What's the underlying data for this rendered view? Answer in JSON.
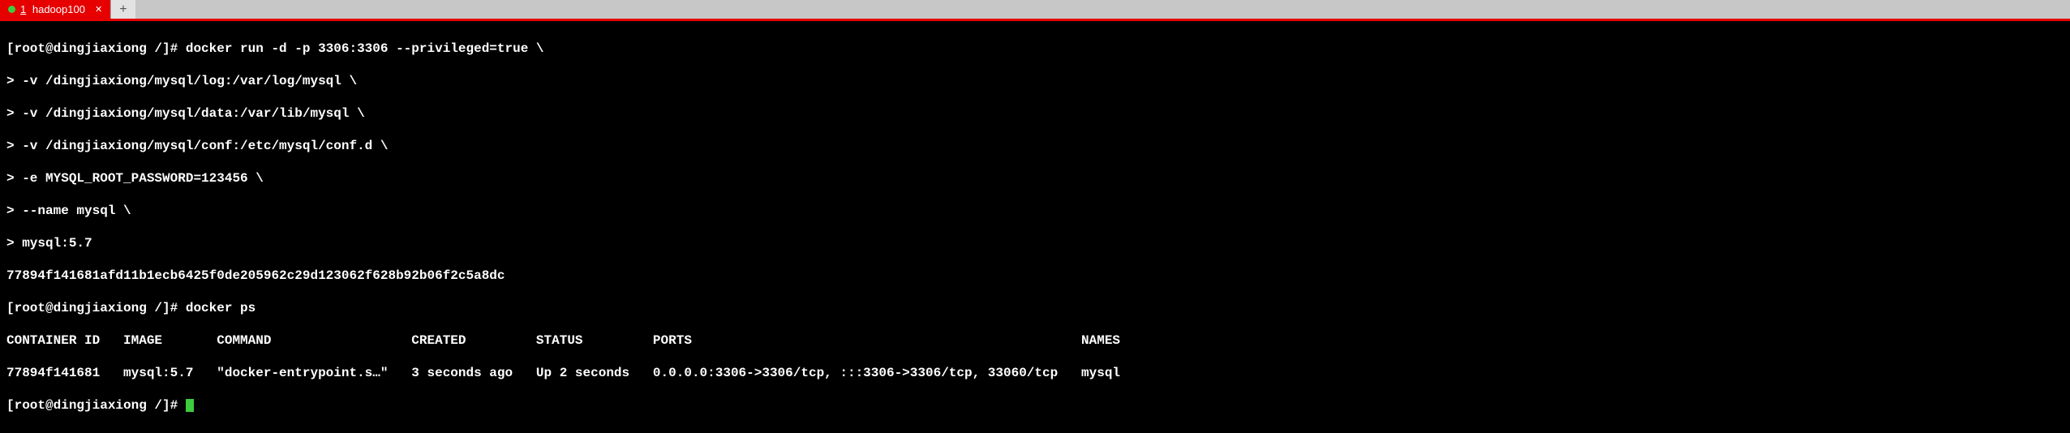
{
  "tabs": {
    "active": {
      "number": "1",
      "label": "hadoop100"
    }
  },
  "terminal": {
    "lines": [
      "[root@dingjiaxiong /]# docker run -d -p 3306:3306 --privileged=true \\",
      "> -v /dingjiaxiong/mysql/log:/var/log/mysql \\",
      "> -v /dingjiaxiong/mysql/data:/var/lib/mysql \\",
      "> -v /dingjiaxiong/mysql/conf:/etc/mysql/conf.d \\",
      "> -e MYSQL_ROOT_PASSWORD=123456 \\",
      "> --name mysql \\",
      "> mysql:5.7",
      "77894f141681afd11b1ecb6425f0de205962c29d123062f628b92b06f2c5a8dc",
      "[root@dingjiaxiong /]# docker ps",
      "CONTAINER ID   IMAGE       COMMAND                  CREATED         STATUS         PORTS                                                  NAMES",
      "77894f141681   mysql:5.7   \"docker-entrypoint.s…\"   3 seconds ago   Up 2 seconds   0.0.0.0:3306->3306/tcp, :::3306->3306/tcp, 33060/tcp   mysql",
      "[root@dingjiaxiong /]# "
    ]
  }
}
